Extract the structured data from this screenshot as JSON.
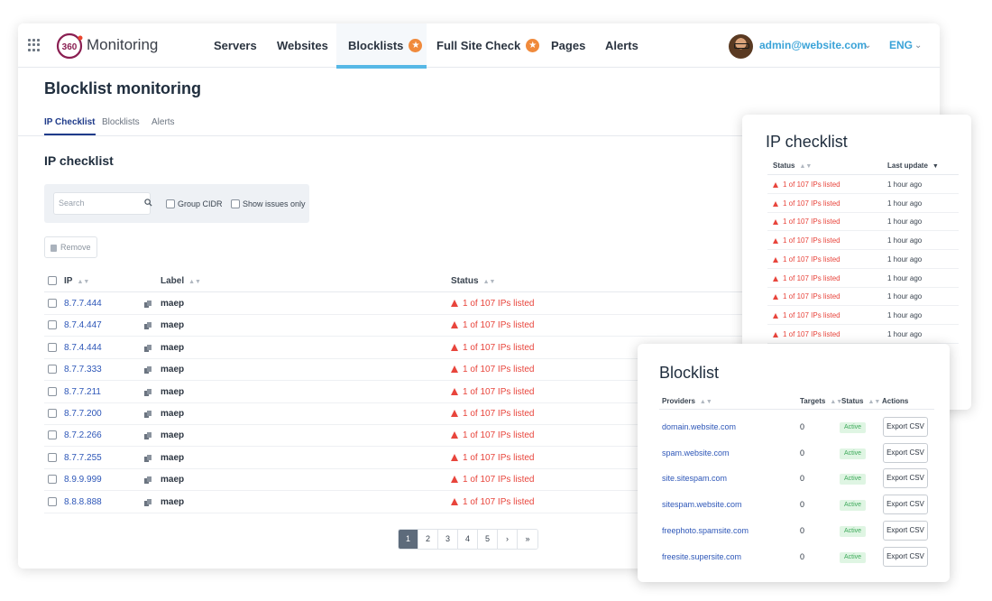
{
  "header": {
    "app_name": "Monitoring",
    "nav": [
      {
        "label": "Servers"
      },
      {
        "label": "Websites"
      },
      {
        "label": "Blocklists"
      },
      {
        "label": "Full Site Check"
      },
      {
        "label": "Pages"
      },
      {
        "label": "Alerts"
      }
    ],
    "active_nav": "Blocklists",
    "user_email": "admin@website.com",
    "language": "ENG",
    "accent_color": "#56b8e6",
    "badge_color": "#f08a3c"
  },
  "page": {
    "title": "Blocklist monitoring",
    "subtabs": [
      {
        "label": "IP Checklist"
      },
      {
        "label": "Blocklists"
      },
      {
        "label": "Alerts"
      }
    ],
    "section_title": "IP checklist"
  },
  "filters": {
    "search_placeholder": "Search",
    "group_cidr_label": "Group CIDR",
    "show_issues_label": "Show issues only",
    "remove_label": "Remove"
  },
  "table": {
    "columns": {
      "ip": "IP",
      "label": "Label",
      "status": "Status"
    },
    "rows": [
      {
        "ip": "8.7.7.444",
        "label": "maep",
        "status": "1 of 107 IPs listed"
      },
      {
        "ip": "8.7.4.447",
        "label": "maep",
        "status": "1 of 107 IPs listed"
      },
      {
        "ip": "8.7.4.444",
        "label": "maep",
        "status": "1 of 107 IPs listed"
      },
      {
        "ip": "8.7.7.333",
        "label": "maep",
        "status": "1 of 107 IPs listed"
      },
      {
        "ip": "8.7.7.211",
        "label": "maep",
        "status": "1 of 107 IPs listed"
      },
      {
        "ip": "8.7.7.200",
        "label": "maep",
        "status": "1 of 107 IPs listed"
      },
      {
        "ip": "8.7.2.266",
        "label": "maep",
        "status": "1 of 107 IPs listed"
      },
      {
        "ip": "8.7.7.255",
        "label": "maep",
        "status": "1 of 107 IPs listed"
      },
      {
        "ip": "8.9.9.999",
        "label": "maep",
        "status": "1 of 107 IPs listed"
      },
      {
        "ip": "8.8.8.888",
        "label": "maep",
        "status": "1 of 107 IPs listed"
      }
    ],
    "status_color": "#e8453c"
  },
  "pagination": {
    "pages": [
      "1",
      "2",
      "3",
      "4",
      "5"
    ],
    "current": "1",
    "next": "›",
    "last": "»"
  },
  "ip_checklist_panel": {
    "title": "IP checklist",
    "columns": {
      "status": "Status",
      "last_update": "Last update"
    },
    "rows": [
      {
        "status": "1 of 107 IPs listed",
        "last_update": "1 hour ago"
      },
      {
        "status": "1 of 107 IPs listed",
        "last_update": "1 hour ago"
      },
      {
        "status": "1 of 107 IPs listed",
        "last_update": "1 hour ago"
      },
      {
        "status": "1 of 107 IPs listed",
        "last_update": "1 hour ago"
      },
      {
        "status": "1 of 107 IPs listed",
        "last_update": "1 hour ago"
      },
      {
        "status": "1 of 107 IPs listed",
        "last_update": "1 hour ago"
      },
      {
        "status": "1 of 107 IPs listed",
        "last_update": "1 hour ago"
      },
      {
        "status": "1 of 107 IPs listed",
        "last_update": "1 hour ago"
      },
      {
        "status": "1 of 107 IPs listed",
        "last_update": "1 hour ago"
      }
    ]
  },
  "blocklist_panel": {
    "title": "Blocklist",
    "columns": {
      "providers": "Providers",
      "targets": "Targets",
      "status": "Status",
      "actions": "Actions"
    },
    "rows": [
      {
        "provider": "domain.website.com",
        "targets": "0",
        "status": "Active",
        "action": "Export CSV"
      },
      {
        "provider": "spam.website.com",
        "targets": "0",
        "status": "Active",
        "action": "Export CSV"
      },
      {
        "provider": "site.sitespam.com",
        "targets": "0",
        "status": "Active",
        "action": "Export CSV"
      },
      {
        "provider": "sitespam.website.com",
        "targets": "0",
        "status": "Active",
        "action": "Export CSV"
      },
      {
        "provider": "freephoto.spamsite.com",
        "targets": "0",
        "status": "Active",
        "action": "Export CSV"
      },
      {
        "provider": "freesite.supersite.com",
        "targets": "0",
        "status": "Active",
        "action": "Export CSV"
      }
    ]
  }
}
